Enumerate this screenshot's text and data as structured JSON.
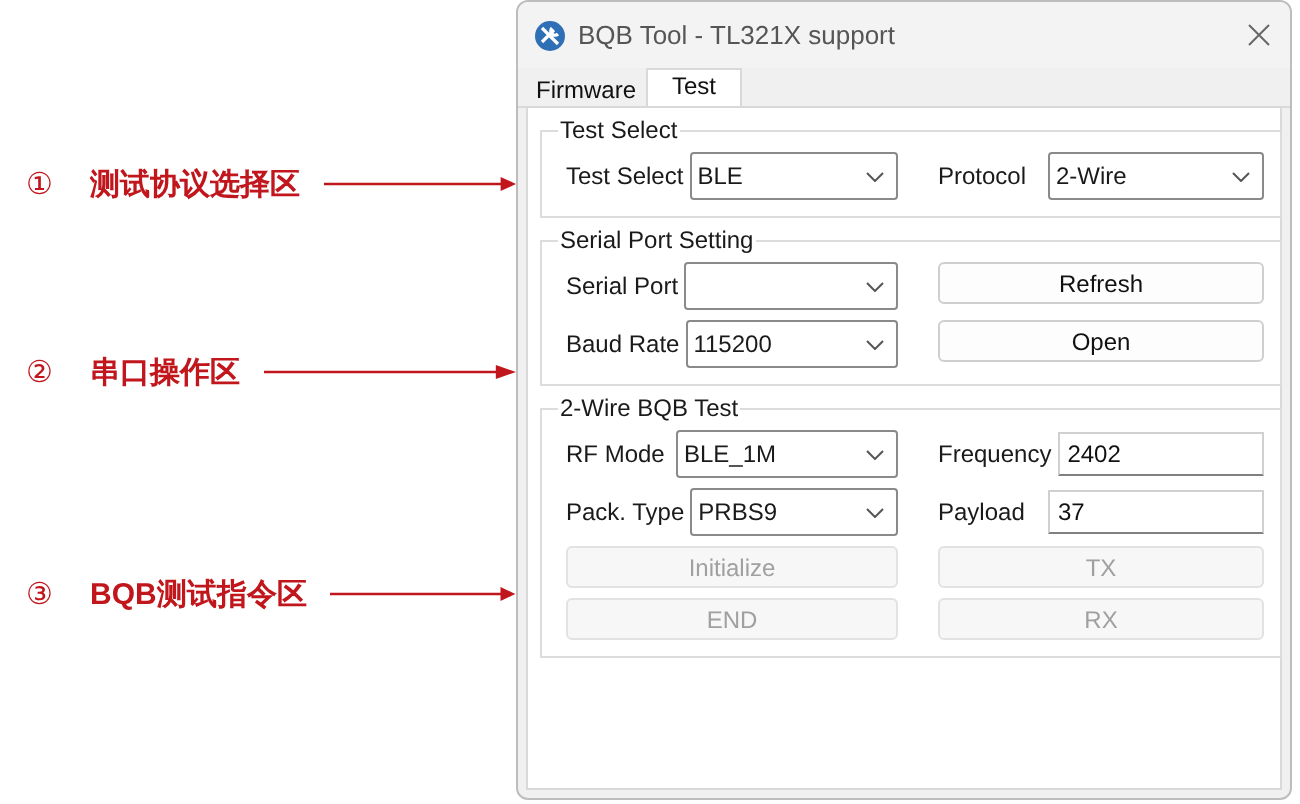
{
  "annotations": [
    {
      "number": "①",
      "label": "测试协议选择区"
    },
    {
      "number": "②",
      "label": "串口操作区"
    },
    {
      "number": "③",
      "label": "BQB测试指令区"
    }
  ],
  "window": {
    "title": "BQB Tool - TL321X support"
  },
  "tabs": [
    {
      "label": "Firmware",
      "selected": false
    },
    {
      "label": "Test",
      "selected": true
    }
  ],
  "groups": [
    {
      "title": "Test Select",
      "items": [
        {
          "kind": "dropdown",
          "label": "Test Select",
          "value": "BLE"
        },
        {
          "kind": "dropdown",
          "label": "Protocol",
          "value": "2-Wire"
        }
      ]
    },
    {
      "title": "Serial Port Setting",
      "items": [
        {
          "kind": "dropdown",
          "label": "Serial Port"
        },
        {
          "kind": "button",
          "label": "Refresh",
          "disabled": false
        },
        {
          "kind": "dropdown",
          "label": "Baud Rate",
          "value": "115200"
        },
        {
          "kind": "button",
          "label": "Open",
          "disabled": false
        }
      ]
    },
    {
      "title": "2-Wire BQB Test",
      "items": [
        {
          "kind": "dropdown",
          "label": "RF Mode",
          "value": "BLE_1M"
        },
        {
          "kind": "text",
          "label": "Frequency",
          "value": "2402"
        },
        {
          "kind": "dropdown",
          "label": "Pack. Type",
          "value": "PRBS9"
        },
        {
          "kind": "text",
          "label": "Payload",
          "value": "37"
        },
        {
          "kind": "button",
          "label": "Initialize",
          "disabled": true
        },
        {
          "kind": "button",
          "label": "TX",
          "disabled": true
        },
        {
          "kind": "button",
          "label": "END",
          "disabled": true
        },
        {
          "kind": "button",
          "label": "RX",
          "disabled": true
        }
      ]
    }
  ]
}
